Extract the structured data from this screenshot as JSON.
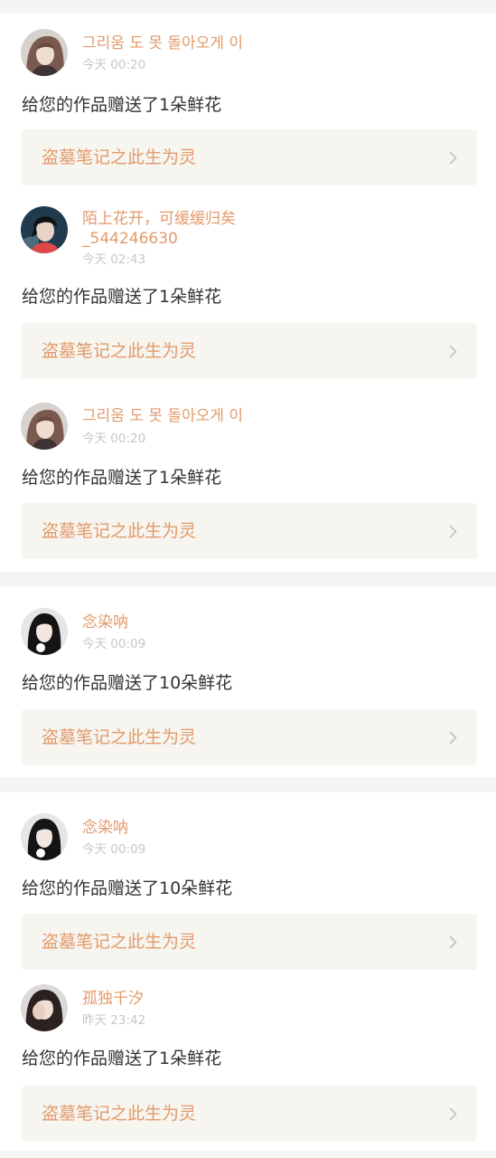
{
  "items": [
    {
      "username": "그리움 도 못 돌아오게 이",
      "time": "今天 00:20",
      "message": "给您的作品赠送了1朵鲜花",
      "work_title": "盗墓笔记之此生为灵",
      "avatar_icon": "avatar-girl-long-hair"
    },
    {
      "username": "陌上花开，可缓缓归矣",
      "username_line2": "_544246630",
      "time": "今天 02:43",
      "message": "给您的作品赠送了1朵鲜花",
      "work_title": "盗墓笔记之此生为灵",
      "avatar_icon": "avatar-boy-dark-hair"
    },
    {
      "username": "그리움 도 못 돌아오게 이",
      "time": "今天 00:20",
      "message": "给您的作品赠送了1朵鲜花",
      "work_title": "盗墓笔记之此生为灵",
      "avatar_icon": "avatar-girl-long-hair"
    },
    {
      "username": "念染呐",
      "time": "今天 00:09",
      "message": "给您的作品赠送了10朵鲜花",
      "work_title": "盗墓笔记之此生为灵",
      "avatar_icon": "avatar-girl-black-hair"
    },
    {
      "username": "念染呐",
      "time": "今天 00:09",
      "message": "给您的作品赠送了10朵鲜花",
      "work_title": "盗墓笔记之此生为灵",
      "avatar_icon": "avatar-girl-black-hair"
    },
    {
      "username": "孤独千汐",
      "time": "昨天 23:42",
      "message": "给您的作品赠送了1朵鲜花",
      "work_title": "盗墓笔记之此生为灵",
      "avatar_icon": "avatar-girl-hand-face"
    }
  ],
  "colors": {
    "username": "#e39a6b",
    "time": "#c7c7c7",
    "message": "#333333",
    "link_bg": "#f6f5ef",
    "chevron": "#c4c4c4",
    "page_bg": "#f5f5f5"
  },
  "icons": {
    "chevron": "chevron-right-icon"
  }
}
